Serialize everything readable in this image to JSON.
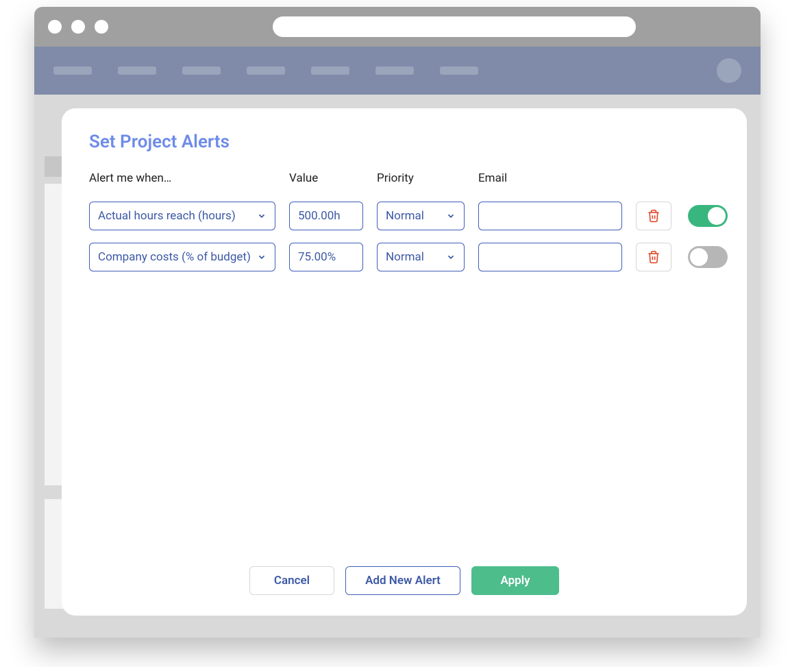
{
  "modal": {
    "title": "Set Project Alerts",
    "columns": {
      "condition": "Alert me when…",
      "value": "Value",
      "priority": "Priority",
      "email": "Email"
    },
    "rows": [
      {
        "condition": "Actual hours reach (hours)",
        "value": "500.00h",
        "priority": "Normal",
        "email": "",
        "enabled": true
      },
      {
        "condition": "Company costs (% of budget)",
        "value": "75.00%",
        "priority": "Normal",
        "email": "",
        "enabled": false
      }
    ],
    "buttons": {
      "cancel": "Cancel",
      "add": "Add New Alert",
      "apply": "Apply"
    }
  },
  "colors": {
    "accent_blue": "#3d59a6",
    "success_green": "#4dbd8c",
    "toggle_green": "#39b67f",
    "delete_red": "#e24b2b",
    "header_bg": "#7f8ba8"
  }
}
